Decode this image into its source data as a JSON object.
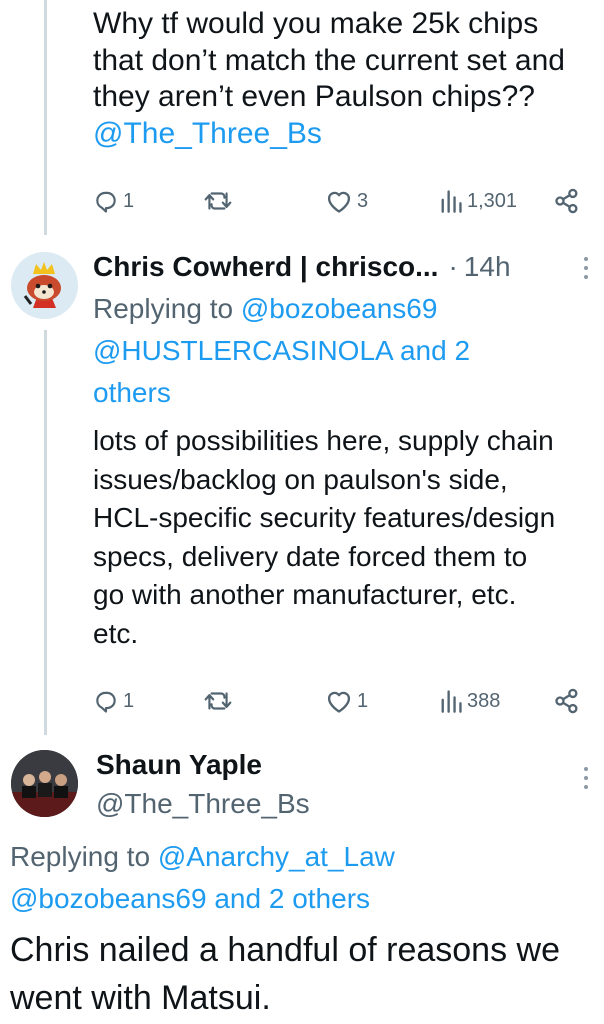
{
  "tweet1": {
    "text": "Why tf would you make 25k chips that don’t match the current set and they aren’t even Paulson chips?? ",
    "mention": "@The_Three_Bs",
    "stats": {
      "replies": "1",
      "retweets": "",
      "likes": "3",
      "views": "1,301"
    }
  },
  "tweet2": {
    "author_name": "Chris Cowherd | chrisco...",
    "time": "14h",
    "replying_prefix": "Replying to ",
    "replying_mention1": "@bozobeans69",
    "replying_mention2": "@HUSTLERCASINOLA and 2 others",
    "text": "lots of possibilities here, supply chain issues/backlog on paulson's side, HCL-specific security features/design specs, delivery date forced them to go with another manufacturer, etc. etc.",
    "stats": {
      "replies": "1",
      "retweets": "",
      "likes": "1",
      "views": "388"
    }
  },
  "tweet3": {
    "author_name": "Shaun Yaple",
    "handle": "@The_Three_Bs",
    "replying_prefix": "Replying to ",
    "replying_mention1": "@Anarchy_at_Law",
    "replying_mention2": "@bozobeans69 and 2 others",
    "text": "Chris nailed a handful of reasons we went with Matsui."
  },
  "separator": "·",
  "colors": {
    "text": "#0f1419",
    "secondary": "#536471",
    "link": "#1d9bf0",
    "thread_line": "#cfd9de"
  }
}
